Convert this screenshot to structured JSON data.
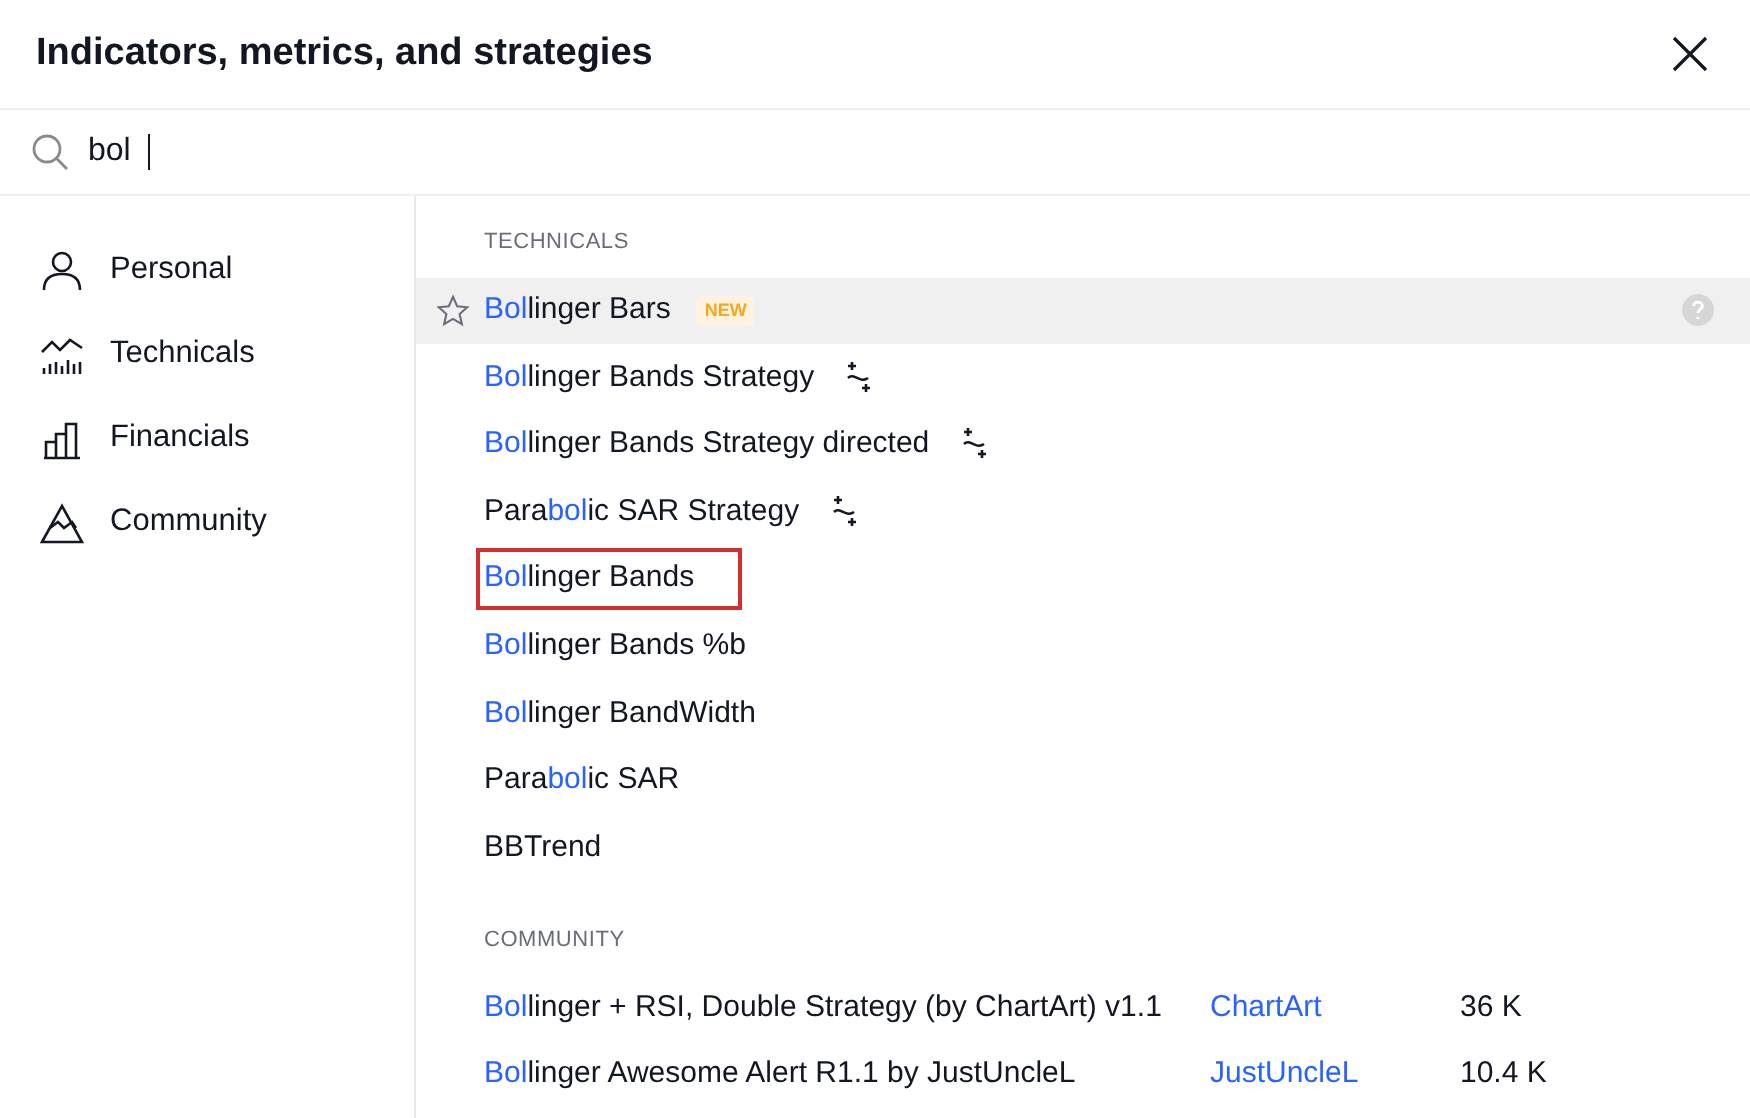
{
  "window": {
    "title": "Indicators, metrics, and strategies"
  },
  "search": {
    "value": "bol"
  },
  "sidebar": {
    "items": [
      {
        "label": "Personal"
      },
      {
        "label": "Technicals"
      },
      {
        "label": "Financials"
      },
      {
        "label": "Community"
      }
    ]
  },
  "sections": [
    {
      "heading": "TECHNICALS",
      "rows": [
        {
          "name": [
            {
              "text": "Bol",
              "match": true
            },
            {
              "text": "linger Bars",
              "match": false
            }
          ],
          "selected": true,
          "badge": "NEW",
          "strategy": false,
          "highlighted": false
        },
        {
          "name": [
            {
              "text": "Bol",
              "match": true
            },
            {
              "text": "linger Bands Strategy",
              "match": false
            }
          ],
          "selected": false,
          "strategy": true,
          "highlighted": false
        },
        {
          "name": [
            {
              "text": "Bol",
              "match": true
            },
            {
              "text": "linger Bands Strategy directed",
              "match": false
            }
          ],
          "selected": false,
          "strategy": true,
          "highlighted": false
        },
        {
          "name": [
            {
              "text": "Para",
              "match": false
            },
            {
              "text": "bol",
              "match": true
            },
            {
              "text": "ic SAR Strategy",
              "match": false
            }
          ],
          "selected": false,
          "strategy": true,
          "highlighted": false
        },
        {
          "name": [
            {
              "text": "Bol",
              "match": true
            },
            {
              "text": "linger Bands",
              "match": false
            }
          ],
          "selected": false,
          "strategy": false,
          "highlighted": true
        },
        {
          "name": [
            {
              "text": "Bol",
              "match": true
            },
            {
              "text": "linger Bands %b",
              "match": false
            }
          ],
          "selected": false,
          "strategy": false,
          "highlighted": false
        },
        {
          "name": [
            {
              "text": "Bol",
              "match": true
            },
            {
              "text": "linger BandWidth",
              "match": false
            }
          ],
          "selected": false,
          "strategy": false,
          "highlighted": false
        },
        {
          "name": [
            {
              "text": "Para",
              "match": false
            },
            {
              "text": "bol",
              "match": true
            },
            {
              "text": "ic SAR",
              "match": false
            }
          ],
          "selected": false,
          "strategy": false,
          "highlighted": false
        },
        {
          "name": [
            {
              "text": "BBTrend",
              "match": false
            }
          ],
          "selected": false,
          "strategy": false,
          "highlighted": false
        }
      ]
    },
    {
      "heading": "COMMUNITY",
      "rows": [
        {
          "name": [
            {
              "text": "Bol",
              "match": true
            },
            {
              "text": "linger + RSI, Double Strategy (by ChartArt) v1.1",
              "match": false
            }
          ],
          "selected": false,
          "strategy": false,
          "highlighted": false,
          "author": "ChartArt",
          "count": "36 K"
        },
        {
          "name": [
            {
              "text": "Bol",
              "match": true
            },
            {
              "text": "linger Awesome Alert R1.1 by JustUncleL",
              "match": false
            }
          ],
          "selected": false,
          "strategy": false,
          "highlighted": false,
          "author": "JustUncleL",
          "count": "10.4 K"
        }
      ]
    }
  ]
}
